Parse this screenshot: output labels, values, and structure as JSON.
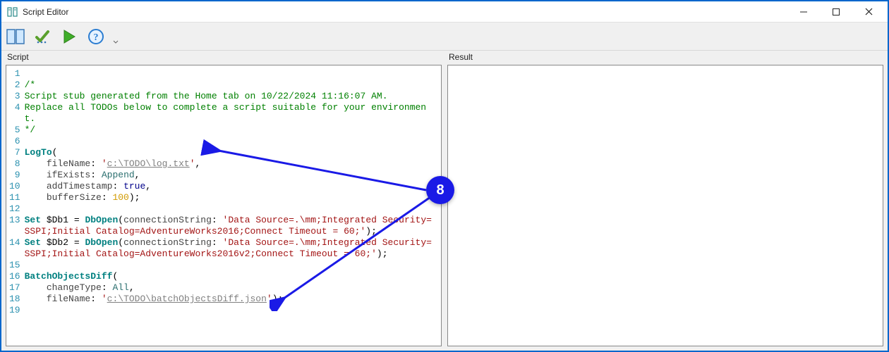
{
  "window": {
    "title": "Script Editor"
  },
  "toolbar": {
    "buttons": {
      "panels": "toggle-panels",
      "check": "validate",
      "run": "run",
      "help": "help"
    }
  },
  "panels": {
    "script_label": "Script",
    "result_label": "Result"
  },
  "callout": {
    "number": "8"
  },
  "code": {
    "lines": [
      {
        "n": "1",
        "segs": []
      },
      {
        "n": "2",
        "segs": [
          {
            "t": "/*",
            "c": "c-comment"
          }
        ]
      },
      {
        "n": "3",
        "segs": [
          {
            "t": "Script stub generated from the Home tab on 10/22/2024 11:16:07 AM.",
            "c": "c-comment"
          }
        ]
      },
      {
        "n": "4",
        "segs": [
          {
            "t": "Replace all TODOs below to complete a script suitable for your environment.",
            "c": "c-comment"
          }
        ]
      },
      {
        "n": "5",
        "segs": [
          {
            "t": "*/",
            "c": "c-comment"
          }
        ]
      },
      {
        "n": "6",
        "segs": []
      },
      {
        "n": "7",
        "segs": [
          {
            "t": "LogTo",
            "c": "c-keyword"
          },
          {
            "t": "(",
            "c": "c-punct"
          }
        ]
      },
      {
        "n": "8",
        "segs": [
          {
            "t": "    fileName",
            "c": "c-param"
          },
          {
            "t": ": ",
            "c": "c-punct"
          },
          {
            "t": "'",
            "c": "c-string"
          },
          {
            "t": "c:\\TODO\\log.txt",
            "c": "c-string-u"
          },
          {
            "t": "'",
            "c": "c-string"
          },
          {
            "t": ",",
            "c": "c-punct"
          }
        ]
      },
      {
        "n": "9",
        "segs": [
          {
            "t": "    ifExists",
            "c": "c-param"
          },
          {
            "t": ": ",
            "c": "c-punct"
          },
          {
            "t": "Append",
            "c": "c-ident"
          },
          {
            "t": ",",
            "c": "c-punct"
          }
        ]
      },
      {
        "n": "10",
        "segs": [
          {
            "t": "    addTimestamp",
            "c": "c-param"
          },
          {
            "t": ": ",
            "c": "c-punct"
          },
          {
            "t": "true",
            "c": "c-bool"
          },
          {
            "t": ",",
            "c": "c-punct"
          }
        ]
      },
      {
        "n": "11",
        "segs": [
          {
            "t": "    bufferSize",
            "c": "c-param"
          },
          {
            "t": ": ",
            "c": "c-punct"
          },
          {
            "t": "100",
            "c": "c-num"
          },
          {
            "t": ");",
            "c": "c-punct"
          }
        ]
      },
      {
        "n": "12",
        "segs": []
      },
      {
        "n": "13",
        "segs": [
          {
            "t": "Set ",
            "c": "c-keyword"
          },
          {
            "t": "$Db1",
            "c": "c-var"
          },
          {
            "t": " = ",
            "c": "c-punct"
          },
          {
            "t": "DbOpen",
            "c": "c-keyword"
          },
          {
            "t": "(",
            "c": "c-punct"
          },
          {
            "t": "connectionString",
            "c": "c-param"
          },
          {
            "t": ": ",
            "c": "c-punct"
          },
          {
            "t": "'Data Source=.\\mm;Integrated Security=SSPI;Initial Catalog=AdventureWorks2016;Connect Timeout = 60;'",
            "c": "c-string"
          },
          {
            "t": ");",
            "c": "c-punct"
          }
        ]
      },
      {
        "n": "14",
        "segs": [
          {
            "t": "Set ",
            "c": "c-keyword"
          },
          {
            "t": "$Db2",
            "c": "c-var"
          },
          {
            "t": " = ",
            "c": "c-punct"
          },
          {
            "t": "DbOpen",
            "c": "c-keyword"
          },
          {
            "t": "(",
            "c": "c-punct"
          },
          {
            "t": "connectionString",
            "c": "c-param"
          },
          {
            "t": ": ",
            "c": "c-punct"
          },
          {
            "t": "'Data Source=.\\mm;Integrated Security=SSPI;Initial Catalog=AdventureWorks2016v2;Connect Timeout = 60;'",
            "c": "c-string"
          },
          {
            "t": ");",
            "c": "c-punct"
          }
        ]
      },
      {
        "n": "15",
        "segs": []
      },
      {
        "n": "16",
        "segs": [
          {
            "t": "BatchObjectsDiff",
            "c": "c-keyword"
          },
          {
            "t": "(",
            "c": "c-punct"
          }
        ]
      },
      {
        "n": "17",
        "segs": [
          {
            "t": "    changeType",
            "c": "c-param"
          },
          {
            "t": ": ",
            "c": "c-punct"
          },
          {
            "t": "All",
            "c": "c-ident"
          },
          {
            "t": ",",
            "c": "c-punct"
          }
        ]
      },
      {
        "n": "18",
        "segs": [
          {
            "t": "    fileName",
            "c": "c-param"
          },
          {
            "t": ": ",
            "c": "c-punct"
          },
          {
            "t": "'",
            "c": "c-string"
          },
          {
            "t": "c:\\TODO\\batchObjectsDiff.json",
            "c": "c-string-u"
          },
          {
            "t": "'",
            "c": "c-string"
          },
          {
            "t": ");",
            "c": "c-punct"
          }
        ]
      },
      {
        "n": "19",
        "segs": []
      }
    ]
  }
}
